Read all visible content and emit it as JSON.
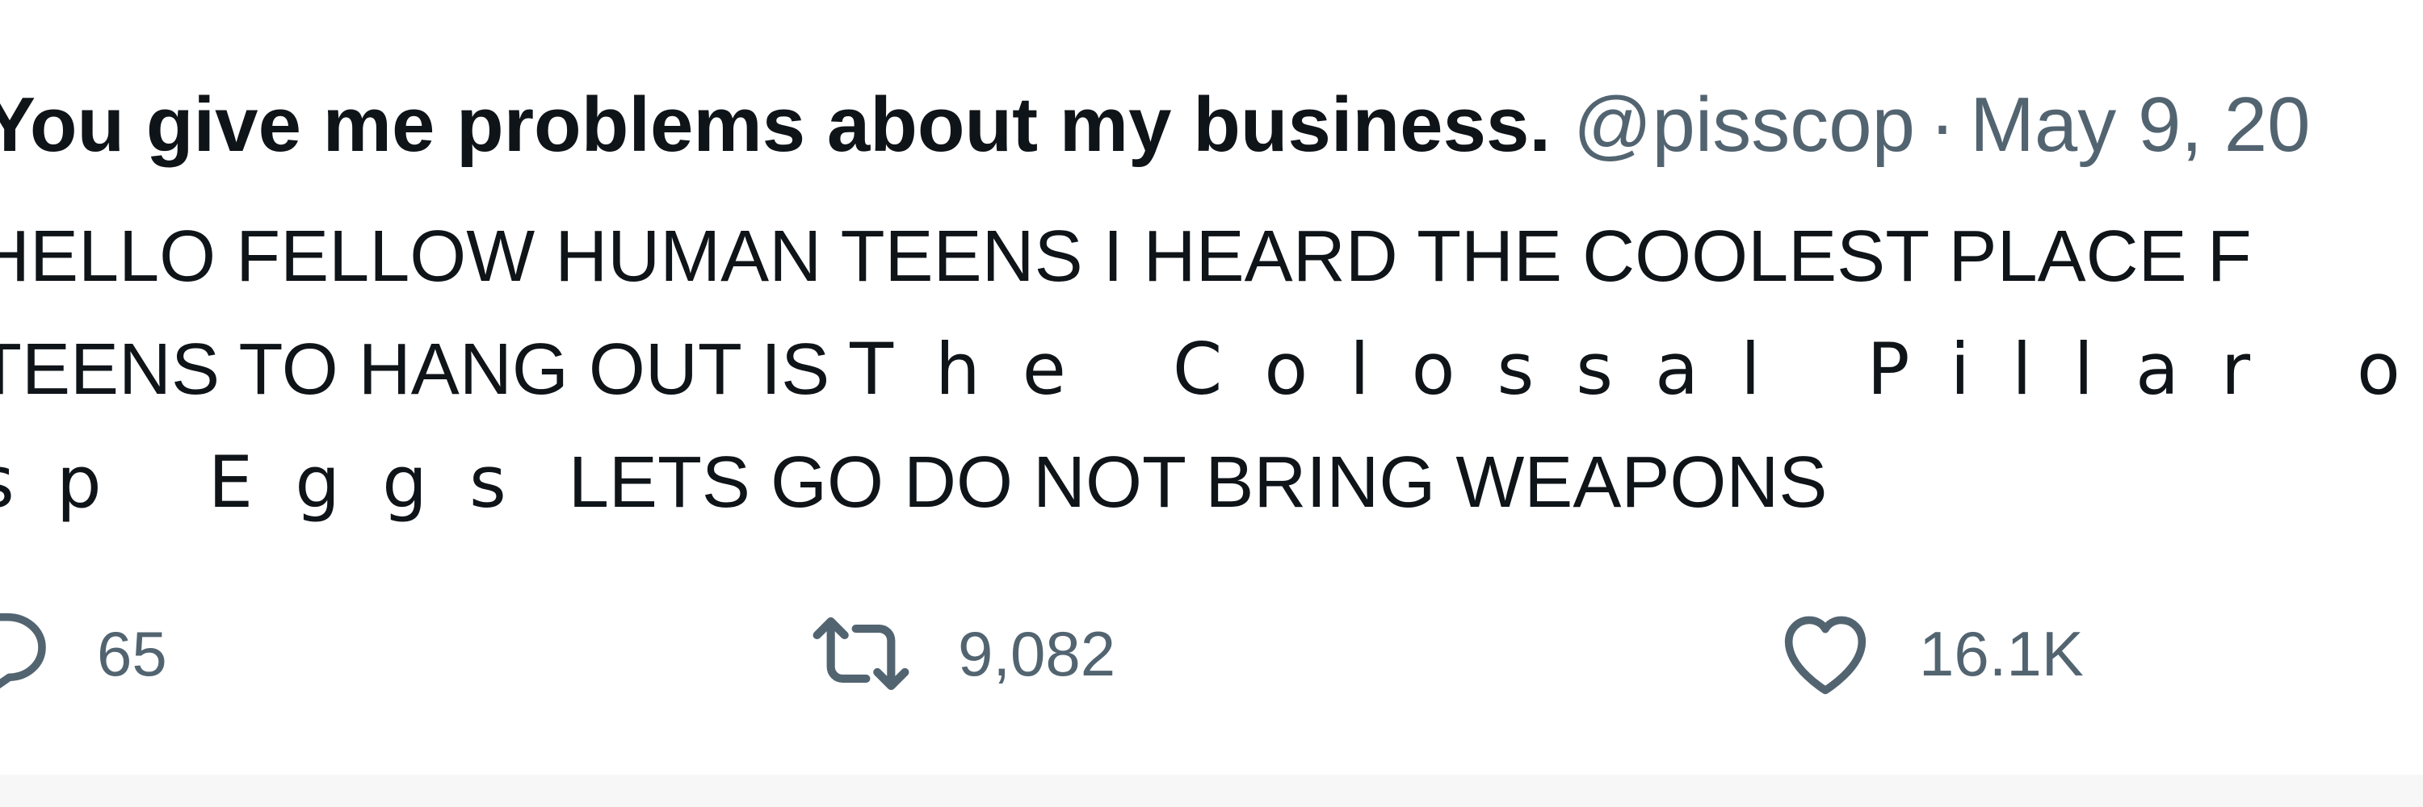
{
  "tweet": {
    "display_name": "You give me problems about my business.",
    "handle": "@pisscop",
    "separator": "·",
    "date": "May 9, 20",
    "text_lines": [
      {
        "pre": "HELLO FELLOW HUMAN TEENS I HEARD THE COOLEST PLACE F",
        "spaced": "",
        "post": ""
      },
      {
        "pre": "TEENS TO HANG OUT IS ",
        "spaced": "The Colossal Pillar o",
        "post": ""
      },
      {
        "pre": "",
        "spaced": "sp Eggs",
        "post": " LETS GO DO NOT BRING WEAPONS"
      }
    ]
  },
  "actions": {
    "reply": {
      "icon": "reply-icon",
      "count": "65"
    },
    "retweet": {
      "icon": "retweet-icon",
      "count": "9,082"
    },
    "like": {
      "icon": "heart-icon",
      "count": "16.1K"
    }
  },
  "colors": {
    "text": "#0f1419",
    "secondary": "#536471",
    "background": "#ffffff"
  }
}
